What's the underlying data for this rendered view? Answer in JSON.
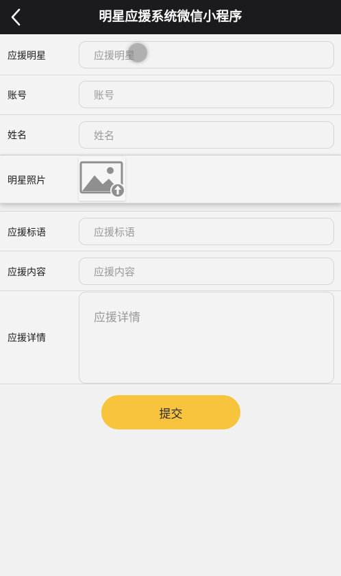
{
  "header": {
    "title": "明星应援系统微信小程序",
    "back_icon": "chevron-left-icon"
  },
  "form": {
    "star": {
      "label": "应援明星",
      "placeholder": "应援明星"
    },
    "account": {
      "label": "账号",
      "placeholder": "账号"
    },
    "name": {
      "label": "姓名",
      "placeholder": "姓名"
    },
    "photo": {
      "label": "明星照片",
      "icon": "image-upload-icon"
    },
    "slogan": {
      "label": "应援标语",
      "placeholder": "应援标语"
    },
    "content": {
      "label": "应援内容",
      "placeholder": "应援内容"
    },
    "details": {
      "label": "应援详情",
      "placeholder": "应援详情"
    }
  },
  "submit": {
    "label": "提交"
  },
  "colors": {
    "header_bg": "#1b1b1d",
    "submit_bg": "#f8c43d"
  }
}
